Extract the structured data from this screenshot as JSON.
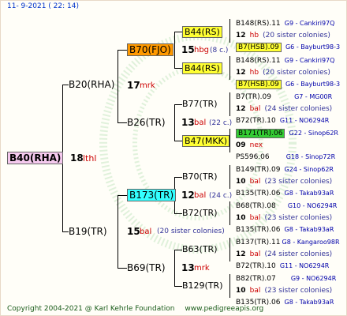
{
  "header": {
    "date": "11-  9-2021 ( 22: 14)"
  },
  "footer": {
    "copyright": "Copyright 2004-2021 @ Karl Kehrle Foundation",
    "url": "www.pedigreeapis.org"
  },
  "colors": {
    "pink": "#f5c9ee",
    "orange": "#ff9900",
    "yellow": "#ffff33",
    "cyan": "#33ffff",
    "green": "#33cc33"
  },
  "root": {
    "name": "B40(RHA)",
    "num": "18",
    "tag": "lthl"
  },
  "gen1": {
    "top": {
      "name": "B20(RHA)",
      "num": "17",
      "tag": "mrk"
    },
    "bottom": {
      "name": "B19(TR)",
      "num": "15",
      "tag": "bal",
      "note": "(20 sister colonies)"
    }
  },
  "gen2": {
    "a": {
      "name": "B70(FJO)",
      "num": "15",
      "tag": "hbg",
      "note": "(8 c.)"
    },
    "b": {
      "name": "B26(TR)",
      "num": "13",
      "tag": "bal",
      "note": "(22 c.)"
    },
    "c": {
      "name": "B173(TR)",
      "num": "12",
      "tag": "bal",
      "note": "(24 c.)"
    },
    "d": {
      "name": "B69(TR)",
      "num": "13",
      "tag": "mrk"
    }
  },
  "gen3": [
    {
      "name": "B44(RS)"
    },
    {
      "name": "B44(RS)"
    },
    {
      "name": "B77(TR)"
    },
    {
      "name": "B47(MKK)",
      "num": "09",
      "tag": "nex"
    },
    {
      "name": "B70(TR)"
    },
    {
      "name": "B72(TR)"
    },
    {
      "name": "B63(TR)"
    },
    {
      "name": "B129(TR)"
    }
  ],
  "gen4": [
    {
      "name": "B148(RS).11",
      "info": "G9 - Cankiri97Q"
    },
    {
      "num": "12",
      "tag": "hb",
      "note": "(20 sister colonies)"
    },
    {
      "name": "B7(HSB).09",
      "info": "G6 - Bayburt98-3"
    },
    {
      "name": "B148(RS).11",
      "info": "G9 - Cankiri97Q"
    },
    {
      "num": "12",
      "tag": "hb",
      "note": "(20 sister colonies)"
    },
    {
      "name": "B7(HSB).09",
      "info": "G6 - Bayburt98-3"
    },
    {
      "name": "B7(TR).09",
      "info": "G7 - MG00R"
    },
    {
      "num": "12",
      "tag": "bal",
      "note": "(24 sister colonies)"
    },
    {
      "name": "B72(TR).10",
      "info": "G11 - NO6294R"
    },
    {
      "name": "B171(TR).06",
      "info": "G22 - Sinop62R"
    },
    {
      "name": "PS596.06",
      "info": "G18 - Sinop72R"
    },
    {
      "name": "B149(TR).09",
      "info": "G24 - Sinop62R"
    },
    {
      "num": "10",
      "tag": "bal",
      "note": "(23 sister colonies)"
    },
    {
      "name": "B135(TR).06",
      "info": "G8 - Takab93aR"
    },
    {
      "name": "B68(TR).08",
      "info": "G10 - NO6294R"
    },
    {
      "num": "10",
      "tag": "bal",
      "note": "(23 sister colonies)"
    },
    {
      "name": "B135(TR).06",
      "info": "G8 - Takab93aR"
    },
    {
      "name": "B137(TR).11",
      "info": "G8 - Kangaroo98R"
    },
    {
      "num": "12",
      "tag": "bal",
      "note": "(24 sister colonies)"
    },
    {
      "name": "B72(TR).10",
      "info": "G11 - NO6294R"
    },
    {
      "name": "B82(TR).07",
      "info": "G9 - NO6294R"
    },
    {
      "num": "10",
      "tag": "bal",
      "note": "(23 sister colonies)"
    },
    {
      "name": "B135(TR).06",
      "info": "G8 - Takab93aR"
    }
  ]
}
